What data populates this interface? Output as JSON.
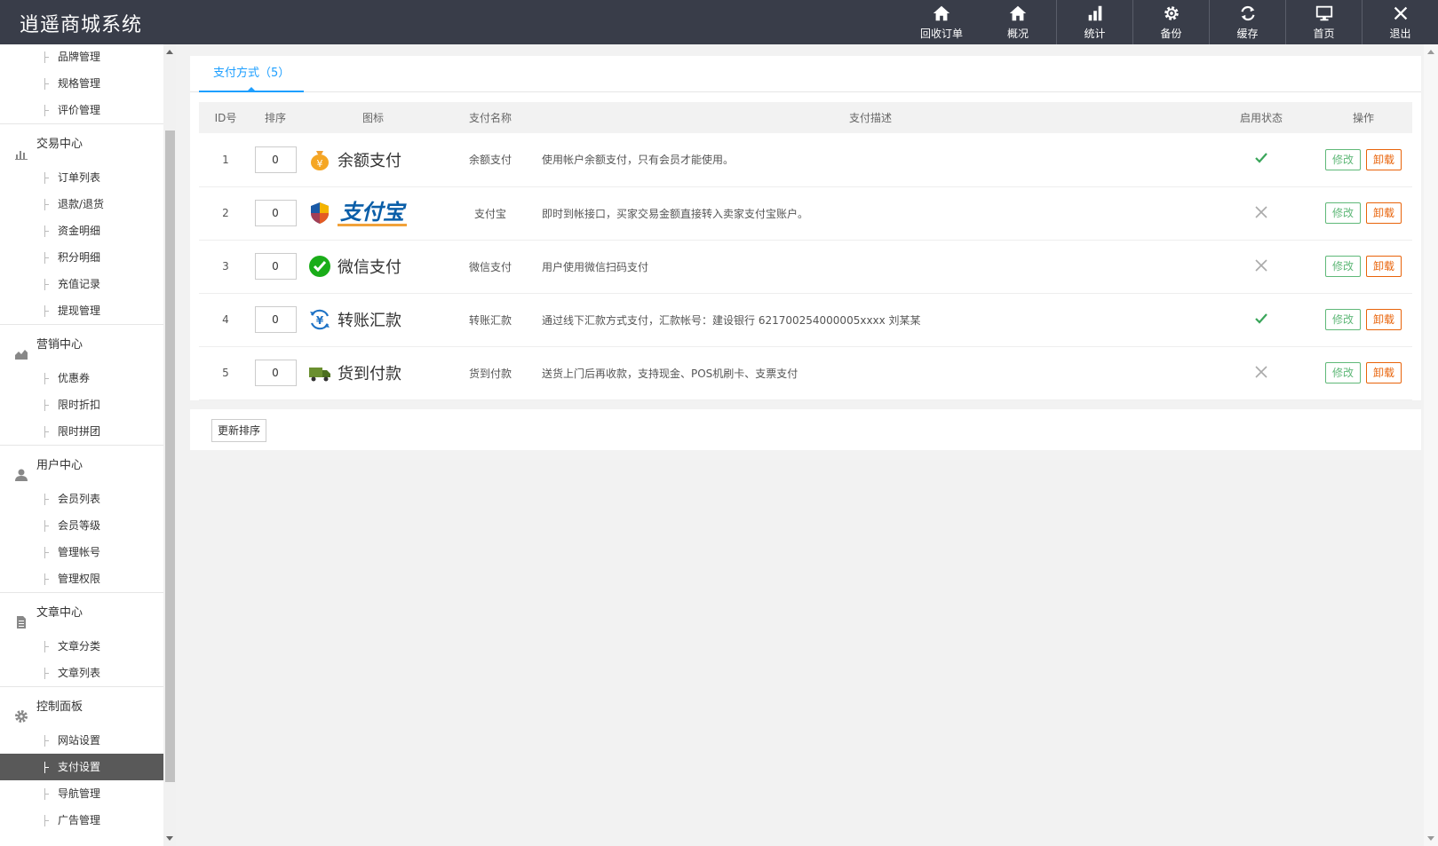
{
  "app": {
    "title": "逍遥商城系统"
  },
  "topnav": [
    {
      "label": "回收订单",
      "icon": "home-icon"
    },
    {
      "label": "概况",
      "icon": "home-icon"
    },
    {
      "label": "统计",
      "icon": "bar-chart-icon"
    },
    {
      "label": "备份",
      "icon": "gear-icon"
    },
    {
      "label": "缓存",
      "icon": "refresh-icon"
    },
    {
      "label": "首页",
      "icon": "monitor-icon"
    },
    {
      "label": "退出",
      "icon": "close-icon"
    }
  ],
  "sidebar": {
    "top_items": [
      "品牌管理",
      "规格管理",
      "评价管理"
    ],
    "groups": [
      {
        "label": "交易中心",
        "icon": "bar-chart-icon",
        "items": [
          "订单列表",
          "退款/退货",
          "资金明细",
          "积分明细",
          "充值记录",
          "提现管理"
        ]
      },
      {
        "label": "营销中心",
        "icon": "area-chart-icon",
        "items": [
          "优惠券",
          "限时折扣",
          "限时拼团"
        ]
      },
      {
        "label": "用户中心",
        "icon": "user-icon",
        "items": [
          "会员列表",
          "会员等级",
          "管理帐号",
          "管理权限"
        ]
      },
      {
        "label": "文章中心",
        "icon": "document-icon",
        "items": [
          "文章分类",
          "文章列表"
        ]
      },
      {
        "label": "控制面板",
        "icon": "gear-icon",
        "items": [
          "网站设置",
          "支付设置",
          "导航管理",
          "广告管理"
        ],
        "active_index": 1
      }
    ]
  },
  "tab": {
    "label": "支付方式（5）"
  },
  "table": {
    "headers": [
      "ID号",
      "排序",
      "图标",
      "支付名称",
      "支付描述",
      "启用状态",
      "操作"
    ],
    "rows": [
      {
        "id": "1",
        "sort": "0",
        "logo_text": "余额支付",
        "logo_icon": "money-bag-icon",
        "name": "余额支付",
        "desc": "使用帐户余额支付，只有会员才能使用。",
        "enabled": true
      },
      {
        "id": "2",
        "sort": "0",
        "logo_text": "支付宝",
        "logo_icon": "shield-icon",
        "name": "支付宝",
        "desc": "即时到帐接口，买家交易金额直接转入卖家支付宝账户。",
        "enabled": false
      },
      {
        "id": "3",
        "sort": "0",
        "logo_text": "微信支付",
        "logo_icon": "wechat-icon",
        "name": "微信支付",
        "desc": "用户使用微信扫码支付",
        "enabled": false
      },
      {
        "id": "4",
        "sort": "0",
        "logo_text": "转账汇款",
        "logo_icon": "yen-transfer-icon",
        "name": "转账汇款",
        "desc": "通过线下汇款方式支付，汇款帐号：建设银行 621700254000005xxxx 刘某某",
        "enabled": true
      },
      {
        "id": "5",
        "sort": "0",
        "logo_text": "货到付款",
        "logo_icon": "truck-icon",
        "name": "货到付款",
        "desc": "送货上门后再收款，支持现金、POS机刷卡、支票支付",
        "enabled": false
      }
    ],
    "edit_label": "修改",
    "uninstall_label": "卸载"
  },
  "footer": {
    "update_sort_label": "更新排序"
  },
  "colors": {
    "topbar": "#393d49",
    "accent": "#1e9fff",
    "enabled": "#5fb878",
    "disabled": "#aaaaaa",
    "edit": "#5fb878",
    "uninstall": "#e8630a"
  }
}
